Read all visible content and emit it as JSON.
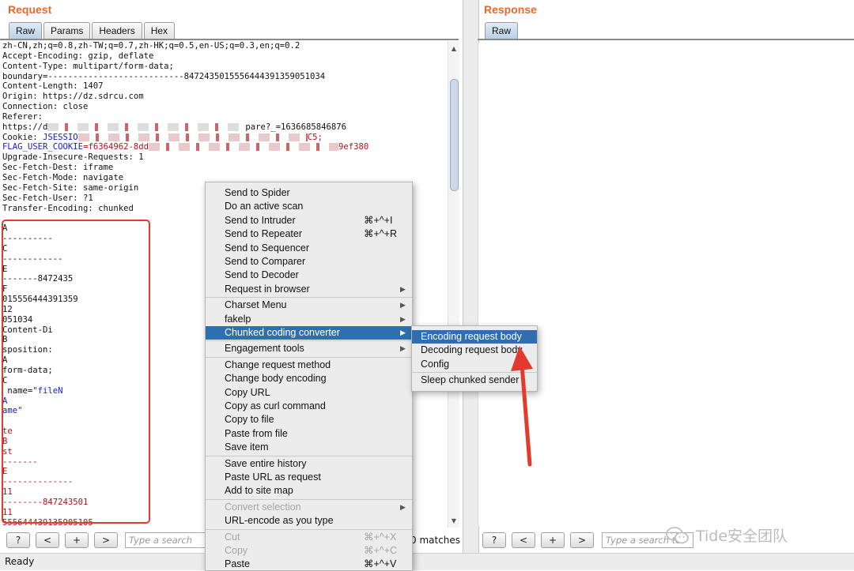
{
  "request": {
    "title": "Request",
    "tabs": [
      "Raw",
      "Params",
      "Headers",
      "Hex"
    ],
    "lines": [
      [
        {
          "t": "zh-CN,zh;q=0.8,zh-TW;q=0.7,zh-HK;q=0.5,en-US;q=0.3,en;q=0.2",
          "c": ""
        }
      ],
      [
        {
          "t": "Accept-Encoding: gzip, deflate",
          "c": ""
        }
      ],
      [
        {
          "t": "Content-Type: multipart/form-data;",
          "c": ""
        }
      ],
      [
        {
          "t": "boundary=---------------------------847243501555644439135905103​4",
          "c": ""
        }
      ],
      [
        {
          "t": "Content-Length: 1407",
          "c": ""
        }
      ],
      [
        {
          "t": "Origin: https://dz.sdrcu.com",
          "c": ""
        }
      ],
      [
        {
          "t": "Connection: close",
          "c": ""
        }
      ],
      [
        {
          "t": "Referer:",
          "c": ""
        }
      ],
      [
        {
          "t": "https://d",
          "c": ""
        },
        {
          "blur": "#ddd",
          "w": 250
        },
        {
          "t": "pare?_=1636685846876",
          "c": ""
        }
      ],
      [
        {
          "t": "Cookie: ",
          "c": ""
        },
        {
          "t": "JSESSIO",
          "c": "blue"
        },
        {
          "blur": "#e8c9cc",
          "w": 290
        },
        {
          "t": "C5;",
          "c": "red"
        }
      ],
      [
        {
          "t": "FLAG_USER_COOKIE",
          "c": "blue"
        },
        {
          "t": "=f6364962-8dd",
          "c": "red"
        },
        {
          "blur": "#e8c9cc",
          "w": 240
        },
        {
          "t": "9ef380",
          "c": "red"
        }
      ],
      [
        {
          "t": "Upgrade-Insecure-Requests: 1",
          "c": ""
        }
      ],
      [
        {
          "t": "Sec-Fetch-Dest: iframe",
          "c": ""
        }
      ],
      [
        {
          "t": "Sec-Fetch-Mode: navigate",
          "c": ""
        }
      ],
      [
        {
          "t": "Sec-Fetch-Site: same-origin",
          "c": ""
        }
      ],
      [
        {
          "t": "Sec-Fetch-User: ?1",
          "c": ""
        }
      ],
      [
        {
          "t": "Transfer-Encoding: chunked",
          "c": ""
        }
      ],
      [
        {
          "t": "",
          "c": ""
        }
      ],
      [
        {
          "t": "A",
          "c": ""
        }
      ],
      [
        {
          "t": "----------",
          "c": ""
        }
      ],
      [
        {
          "t": "C",
          "c": ""
        }
      ],
      [
        {
          "t": "------------",
          "c": ""
        }
      ],
      [
        {
          "t": "E",
          "c": ""
        }
      ],
      [
        {
          "t": "-------8472435",
          "c": ""
        }
      ],
      [
        {
          "t": "F",
          "c": ""
        }
      ],
      [
        {
          "t": "015556444391359",
          "c": ""
        }
      ],
      [
        {
          "t": "12",
          "c": ""
        }
      ],
      [
        {
          "t": "051034",
          "c": ""
        }
      ],
      [
        {
          "t": "Content-Di",
          "c": ""
        }
      ],
      [
        {
          "t": "B",
          "c": ""
        }
      ],
      [
        {
          "t": "sposition:",
          "c": ""
        }
      ],
      [
        {
          "t": "A",
          "c": ""
        }
      ],
      [
        {
          "t": "form-data;",
          "c": ""
        }
      ],
      [
        {
          "t": "C",
          "c": ""
        }
      ],
      [
        {
          "t": " name=",
          "c": ""
        },
        {
          "t": "\"fileN",
          "c": "blue"
        }
      ],
      [
        {
          "t": "A",
          "c": "blue"
        }
      ],
      [
        {
          "t": "ame\"",
          "c": "blue"
        }
      ],
      [
        {
          "t": "",
          "c": ""
        }
      ],
      [
        {
          "t": "te",
          "c": "red"
        }
      ],
      [
        {
          "t": "B",
          "c": "red"
        }
      ],
      [
        {
          "t": "st",
          "c": "red"
        }
      ],
      [
        {
          "t": "-------",
          "c": "red"
        }
      ],
      [
        {
          "t": "E",
          "c": "red"
        }
      ],
      [
        {
          "t": "--------------",
          "c": "red"
        }
      ],
      [
        {
          "t": "11",
          "c": "red"
        }
      ],
      [
        {
          "t": "--------847243501",
          "c": "red"
        }
      ],
      [
        {
          "t": "11",
          "c": "red"
        }
      ],
      [
        {
          "t": "555644439135905105",
          "c": "red"
        }
      ]
    ],
    "search_placeholder": "Type a search ter",
    "matches": "0 matches",
    "buttons": {
      "help": "?",
      "prev": "<",
      "add": "+",
      "next": ">"
    }
  },
  "response": {
    "title": "Response",
    "tabs": [
      "Raw"
    ],
    "search_placeholder": "Type a search te",
    "buttons": {
      "help": "?",
      "prev": "<",
      "add": "+",
      "next": ">"
    }
  },
  "context_menu": {
    "items": [
      {
        "label": "Send to Spider"
      },
      {
        "label": "Do an active scan"
      },
      {
        "label": "Send to Intruder",
        "shortcut": "⌘+^+I"
      },
      {
        "label": "Send to Repeater",
        "shortcut": "⌘+^+R"
      },
      {
        "label": "Send to Sequencer"
      },
      {
        "label": "Send to Comparer"
      },
      {
        "label": "Send to Decoder"
      },
      {
        "label": "Request in browser",
        "submenu": true
      },
      {
        "sep": true
      },
      {
        "label": "Charset Menu",
        "submenu": true
      },
      {
        "label": "fakelp",
        "submenu": true
      },
      {
        "label": "Chunked coding converter",
        "submenu": true,
        "highlighted": true
      },
      {
        "sep": true
      },
      {
        "label": "Engagement tools",
        "submenu": true
      },
      {
        "sep": true
      },
      {
        "label": "Change request method"
      },
      {
        "label": "Change body encoding"
      },
      {
        "label": "Copy URL"
      },
      {
        "label": "Copy as curl command"
      },
      {
        "label": "Copy to file"
      },
      {
        "label": "Paste from file"
      },
      {
        "label": "Save item"
      },
      {
        "sep": true
      },
      {
        "label": "Save entire history"
      },
      {
        "label": "Paste URL as request"
      },
      {
        "label": "Add to site map"
      },
      {
        "sep": true
      },
      {
        "label": "Convert selection",
        "submenu": true,
        "disabled": true
      },
      {
        "label": "URL-encode as you type"
      },
      {
        "sep": true
      },
      {
        "label": "Cut",
        "shortcut": "⌘+^+X",
        "disabled": true
      },
      {
        "label": "Copy",
        "shortcut": "⌘+^+C",
        "disabled": true
      },
      {
        "label": "Paste",
        "shortcut": "⌘+^+V"
      }
    ]
  },
  "submenu": {
    "items": [
      {
        "label": "Encoding request body",
        "highlighted": true
      },
      {
        "label": "Decoding request body"
      },
      {
        "label": "Config"
      },
      {
        "sep": true
      },
      {
        "label": "Sleep chunked sender"
      }
    ]
  },
  "status": "Ready",
  "watermark": "Tide安全团队",
  "colors": {
    "title": "#e8692c",
    "highlight": "#2f6fb0",
    "annotation": "#e23b2e"
  }
}
